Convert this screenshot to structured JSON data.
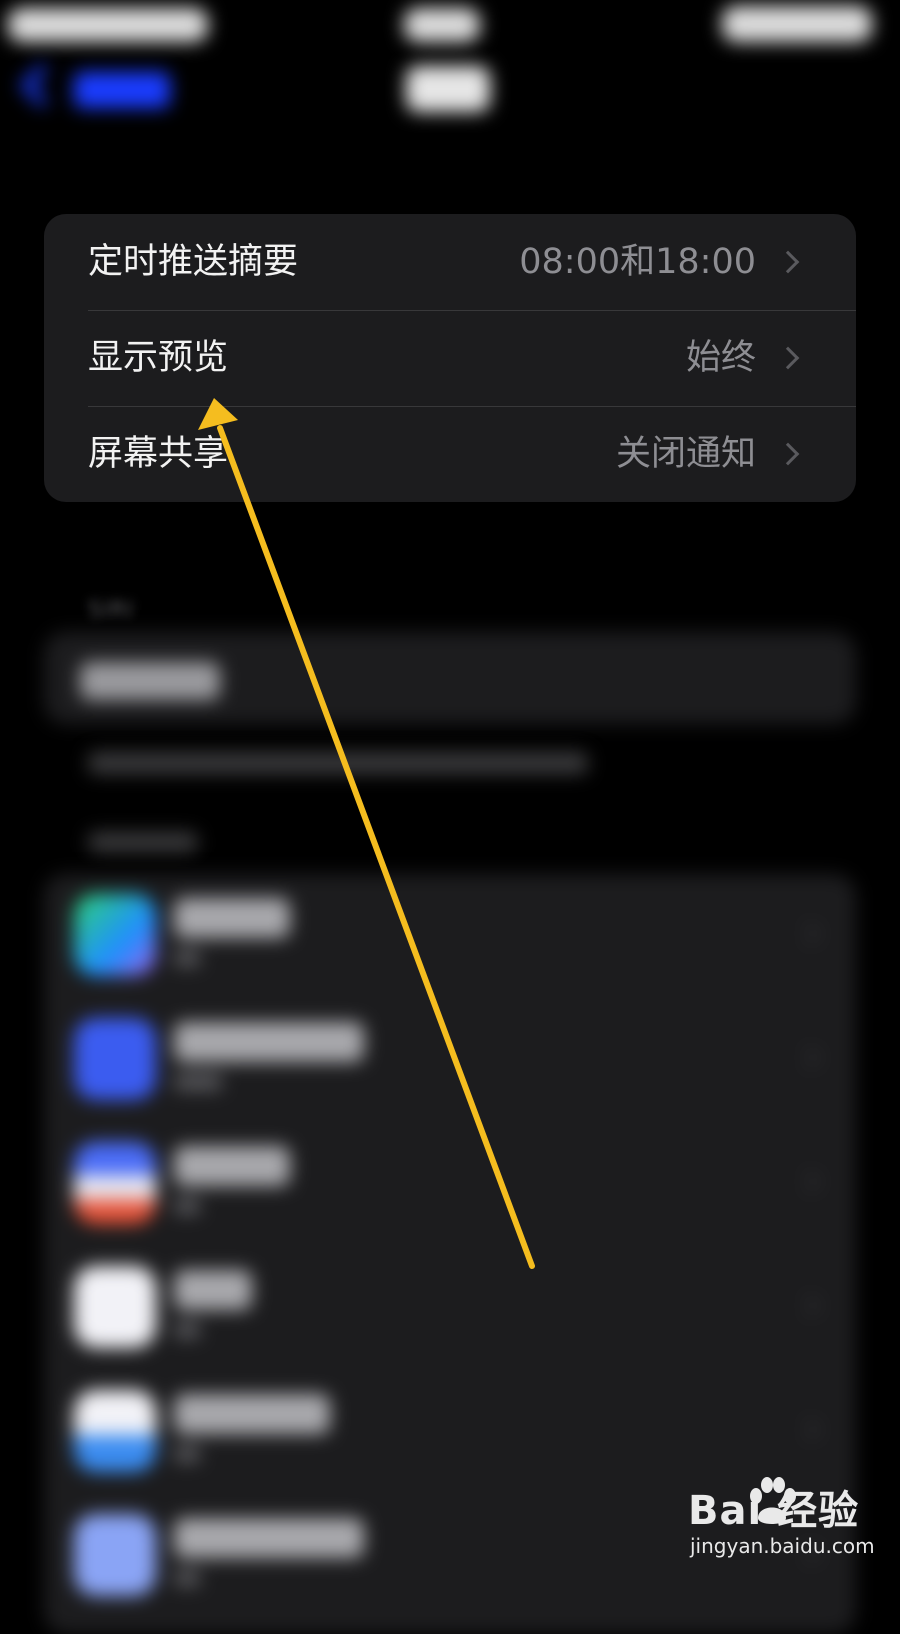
{
  "settings_group": {
    "rows": [
      {
        "label": "定时推送摘要",
        "value": "08:00和18:00"
      },
      {
        "label": "显示预览",
        "value": "始终"
      },
      {
        "label": "屏幕共享",
        "value": "关闭通知"
      }
    ]
  },
  "siri_section": {
    "header": "SIRI"
  },
  "annotation": {
    "color": "#f5bd1f"
  },
  "watermark": {
    "brand": "Bai 经验",
    "url": "jingyan.baidu.com"
  },
  "colors": {
    "background": "#000000",
    "cell": "#1c1c1e",
    "separator": "#38383a",
    "label": "#f2f2f2",
    "secondary": "#8e8e93",
    "accent": "#1a3cff"
  }
}
